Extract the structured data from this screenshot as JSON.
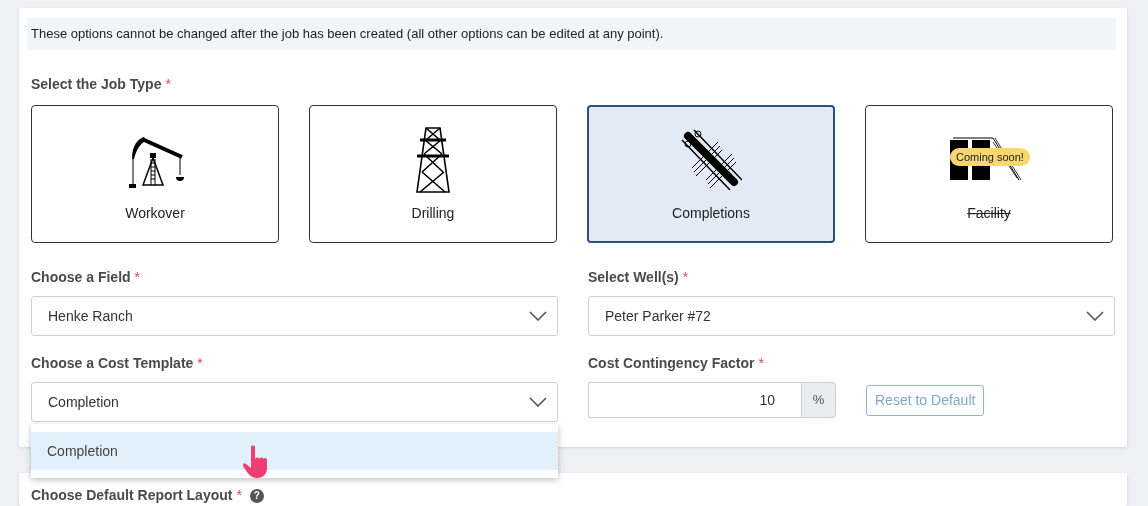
{
  "notice": "These options cannot be changed after the job has been created (all other options can be edited at any point).",
  "job_type": {
    "label": "Select the Job Type",
    "required_mark": "*",
    "options": [
      {
        "label": "Workover",
        "kind": "pumpjack",
        "selected": false,
        "disabled": false
      },
      {
        "label": "Drilling",
        "kind": "derrick",
        "selected": false,
        "disabled": false
      },
      {
        "label": "Completions",
        "kind": "pipes",
        "selected": true,
        "disabled": false
      },
      {
        "label": "Facility",
        "kind": "tanks",
        "selected": false,
        "disabled": true,
        "badge": "Coming soon!"
      }
    ]
  },
  "field": {
    "label": "Choose a Field",
    "required_mark": "*",
    "value": "Henke Ranch"
  },
  "wells": {
    "label": "Select Well(s)",
    "required_mark": "*",
    "value": "Peter Parker #72"
  },
  "cost_template": {
    "label": "Choose a Cost Template",
    "required_mark": "*",
    "value": "Completion",
    "expanded": true,
    "options": [
      {
        "label": "Completion",
        "selected": true
      }
    ]
  },
  "contingency": {
    "label": "Cost Contingency Factor",
    "required_mark": "*",
    "value": "10",
    "unit": "%"
  },
  "reset_button": {
    "label": "Reset to Default",
    "disabled": true
  },
  "report_layout": {
    "label": "Choose Default Report Layout",
    "required_mark": "*",
    "help": "?"
  }
}
